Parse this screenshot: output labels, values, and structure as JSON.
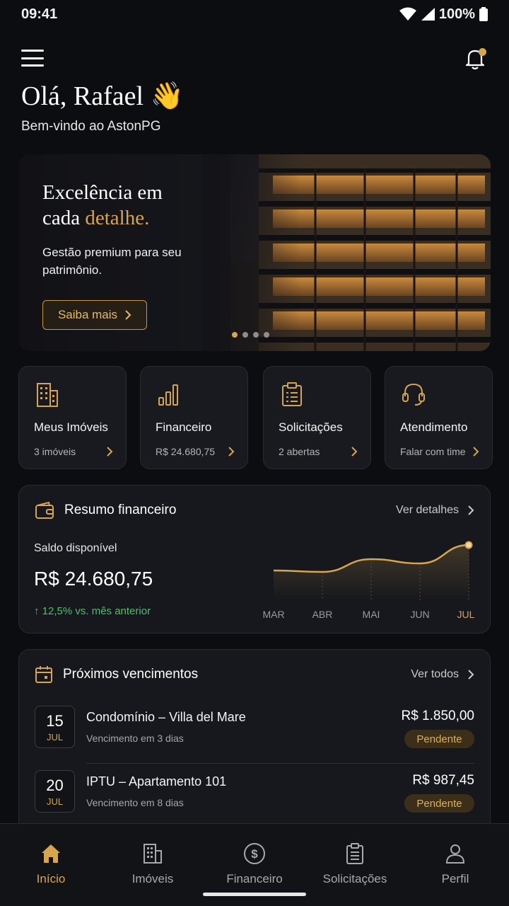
{
  "status_bar": {
    "time": "09:41",
    "battery": "100%"
  },
  "header": {
    "greeting": "Olá, Rafael 👋",
    "welcome": "Bem-vindo ao AstonPG"
  },
  "hero": {
    "title_line1": "Excelência em",
    "title_line2_prefix": "cada ",
    "title_line2_accent": "detalhe.",
    "subtitle": "Gestão premium para seu patrimônio.",
    "button_label": "Saiba mais",
    "slides": 4,
    "active_slide": 1
  },
  "quick_actions": [
    {
      "title": "Meus Imóveis",
      "subtitle": "3 imóveis",
      "icon": "building-icon"
    },
    {
      "title": "Financeiro",
      "subtitle": "R$ 24.680,75",
      "icon": "bar-chart-icon"
    },
    {
      "title": "Solicitações",
      "subtitle": "2 abertas",
      "icon": "clipboard-icon"
    },
    {
      "title": "Atendimento",
      "subtitle": "Falar com time",
      "icon": "headset-icon"
    }
  ],
  "financial_summary": {
    "title": "Resumo financeiro",
    "link": "Ver detalhes",
    "balance_label": "Saldo disponível",
    "balance_value": "R$ 24.680,75",
    "change": "↑ 12,5% vs. mês anterior",
    "chart_data": {
      "type": "area",
      "categories": [
        "MAR",
        "ABR",
        "MAI",
        "JUN",
        "JUL"
      ],
      "series": [
        {
          "values": [
            42,
            40,
            58,
            52,
            78
          ]
        }
      ],
      "highlight": "JUL",
      "ylim": [
        0,
        100
      ]
    }
  },
  "upcoming": {
    "title": "Próximos vencimentos",
    "link": "Ver todos",
    "items": [
      {
        "day": "15",
        "month": "JUL",
        "name": "Condomínio – Villa del Mare",
        "due": "Vencimento em 3 dias",
        "amount": "R$ 1.850,00",
        "status": "Pendente"
      },
      {
        "day": "20",
        "month": "JUL",
        "name": "IPTU – Apartamento 101",
        "due": "Vencimento em 8 dias",
        "amount": "R$ 987,45",
        "status": "Pendente"
      }
    ]
  },
  "bottom_nav": [
    {
      "label": "Início",
      "icon": "home-icon",
      "active": true
    },
    {
      "label": "Imóveis",
      "icon": "building-icon",
      "active": false
    },
    {
      "label": "Financeiro",
      "icon": "dollar-circle-icon",
      "active": false
    },
    {
      "label": "Solicitações",
      "icon": "clipboard-icon",
      "active": false
    },
    {
      "label": "Perfil",
      "icon": "user-icon",
      "active": false
    }
  ],
  "colors": {
    "accent": "#d6a54e",
    "background": "#0c0d10",
    "card": "#17181d",
    "positive": "#4fbf6b"
  }
}
